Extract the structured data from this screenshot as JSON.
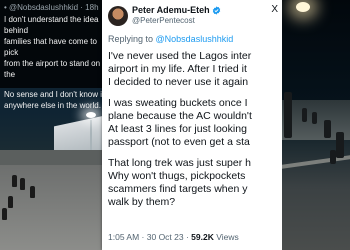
{
  "left_tweet": {
    "handle_line": "• @Nobsdaslushhkid · 18h",
    "body_line1": "I don't understand the idea behind",
    "body_line2": "families that have come to pick",
    "body_line3": "from the airport to stand on the",
    "body_line4": "No sense and I don't know it",
    "body_line5": "anywhere else in the world."
  },
  "tweet": {
    "display_name": "Peter Ademu-Eteh",
    "handle": "@PeterPentecost",
    "close_symbol": "X",
    "replying_prefix": "Replying to ",
    "replying_mention": "@Nobsdaslushhkid",
    "paragraphs": [
      [
        "I've never used the Lagos inter",
        "airport in my life. After I tried it",
        "I decided to never use it again"
      ],
      [
        "I was sweating buckets once I",
        "plane because the AC wouldn't",
        "At least 3 lines for just looking",
        "passport (not to even get a sta"
      ],
      [
        "That long trek was just super h",
        "Why won't thugs, pickpockets",
        "scammers find targets when y",
        "walk by them?"
      ]
    ],
    "time": "1:05 AM",
    "date": "30 Oct 23",
    "views_count": "59.2K",
    "views_label": "Views"
  },
  "colors": {
    "link": "#1d9bf0",
    "verified": "#1d9bf0",
    "muted_text": "#536471"
  },
  "icons": {
    "verified": "verified-badge-icon",
    "close": "x-close-icon"
  }
}
